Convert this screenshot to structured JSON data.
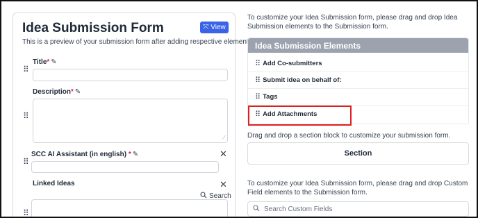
{
  "form": {
    "title": "Idea Submission Form",
    "view_label": "View",
    "view_icon": "expand-arrows-icon",
    "subtitle": "This is a preview of your submission form after adding respective elements.",
    "fields": {
      "title": {
        "label": "Title",
        "required": "*"
      },
      "description": {
        "label": "Description",
        "required": "*"
      },
      "scc": {
        "label": "SCC AI Assistant (in english) ",
        "required": "*"
      },
      "linked": {
        "label": "Linked Ideas",
        "search_label": "Search"
      }
    }
  },
  "right": {
    "intro_text": "To customize your Idea Submission form, please drag and drop Idea Submission elements to the Submission form.",
    "elements_header": "Idea Submission Elements",
    "elements": [
      "Add Co-submitters",
      "Submit idea on behalf of:",
      "Tags",
      "Add Attachments"
    ],
    "section_hint": "Drag and drop a section block to customize your submission form.",
    "section_label": "Section",
    "custom_text": "To customize your Idea Submission form, please drag and drop Custom Field elements to the Submission form.",
    "search_placeholder": "Search Custom Fields"
  },
  "colors": {
    "accent": "#3b63e8",
    "header_gray": "#9ca3af",
    "highlight_red": "#e02020",
    "required_red": "#e11d48"
  }
}
